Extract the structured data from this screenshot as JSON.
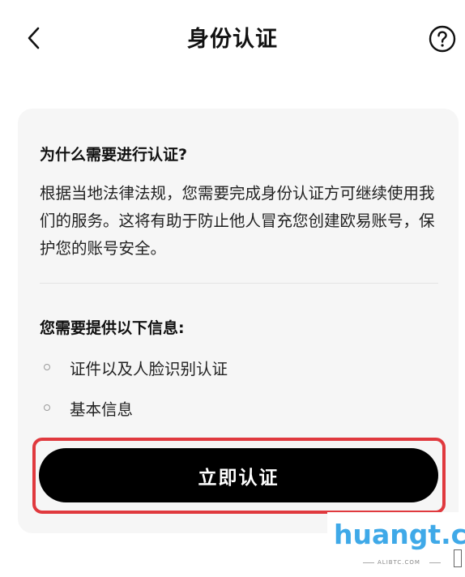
{
  "header": {
    "title": "身份认证",
    "back_icon": "chevron-left-icon",
    "help_icon": "question-circle-icon"
  },
  "card": {
    "why_title": "为什么需要进行认证?",
    "why_body": "根据当地法律法规，您需要完成身份认证方可继续使用我们的服务。这将有助于防止他人冒充您创建欧易账号，保护您的账号安全。",
    "need_title": "您需要提供以下信息:",
    "requirements": [
      "证件以及人脸识别认证",
      "基本信息"
    ]
  },
  "actions": {
    "verify_label": "立即认证"
  },
  "watermark": {
    "logo": "huangt.cn",
    "subtext": "ALIBTC.COM"
  },
  "colors": {
    "primary_button": "#000000",
    "highlight": "#e0393e",
    "card_bg": "#f6f6f6",
    "watermark": "#3fa9e8"
  }
}
